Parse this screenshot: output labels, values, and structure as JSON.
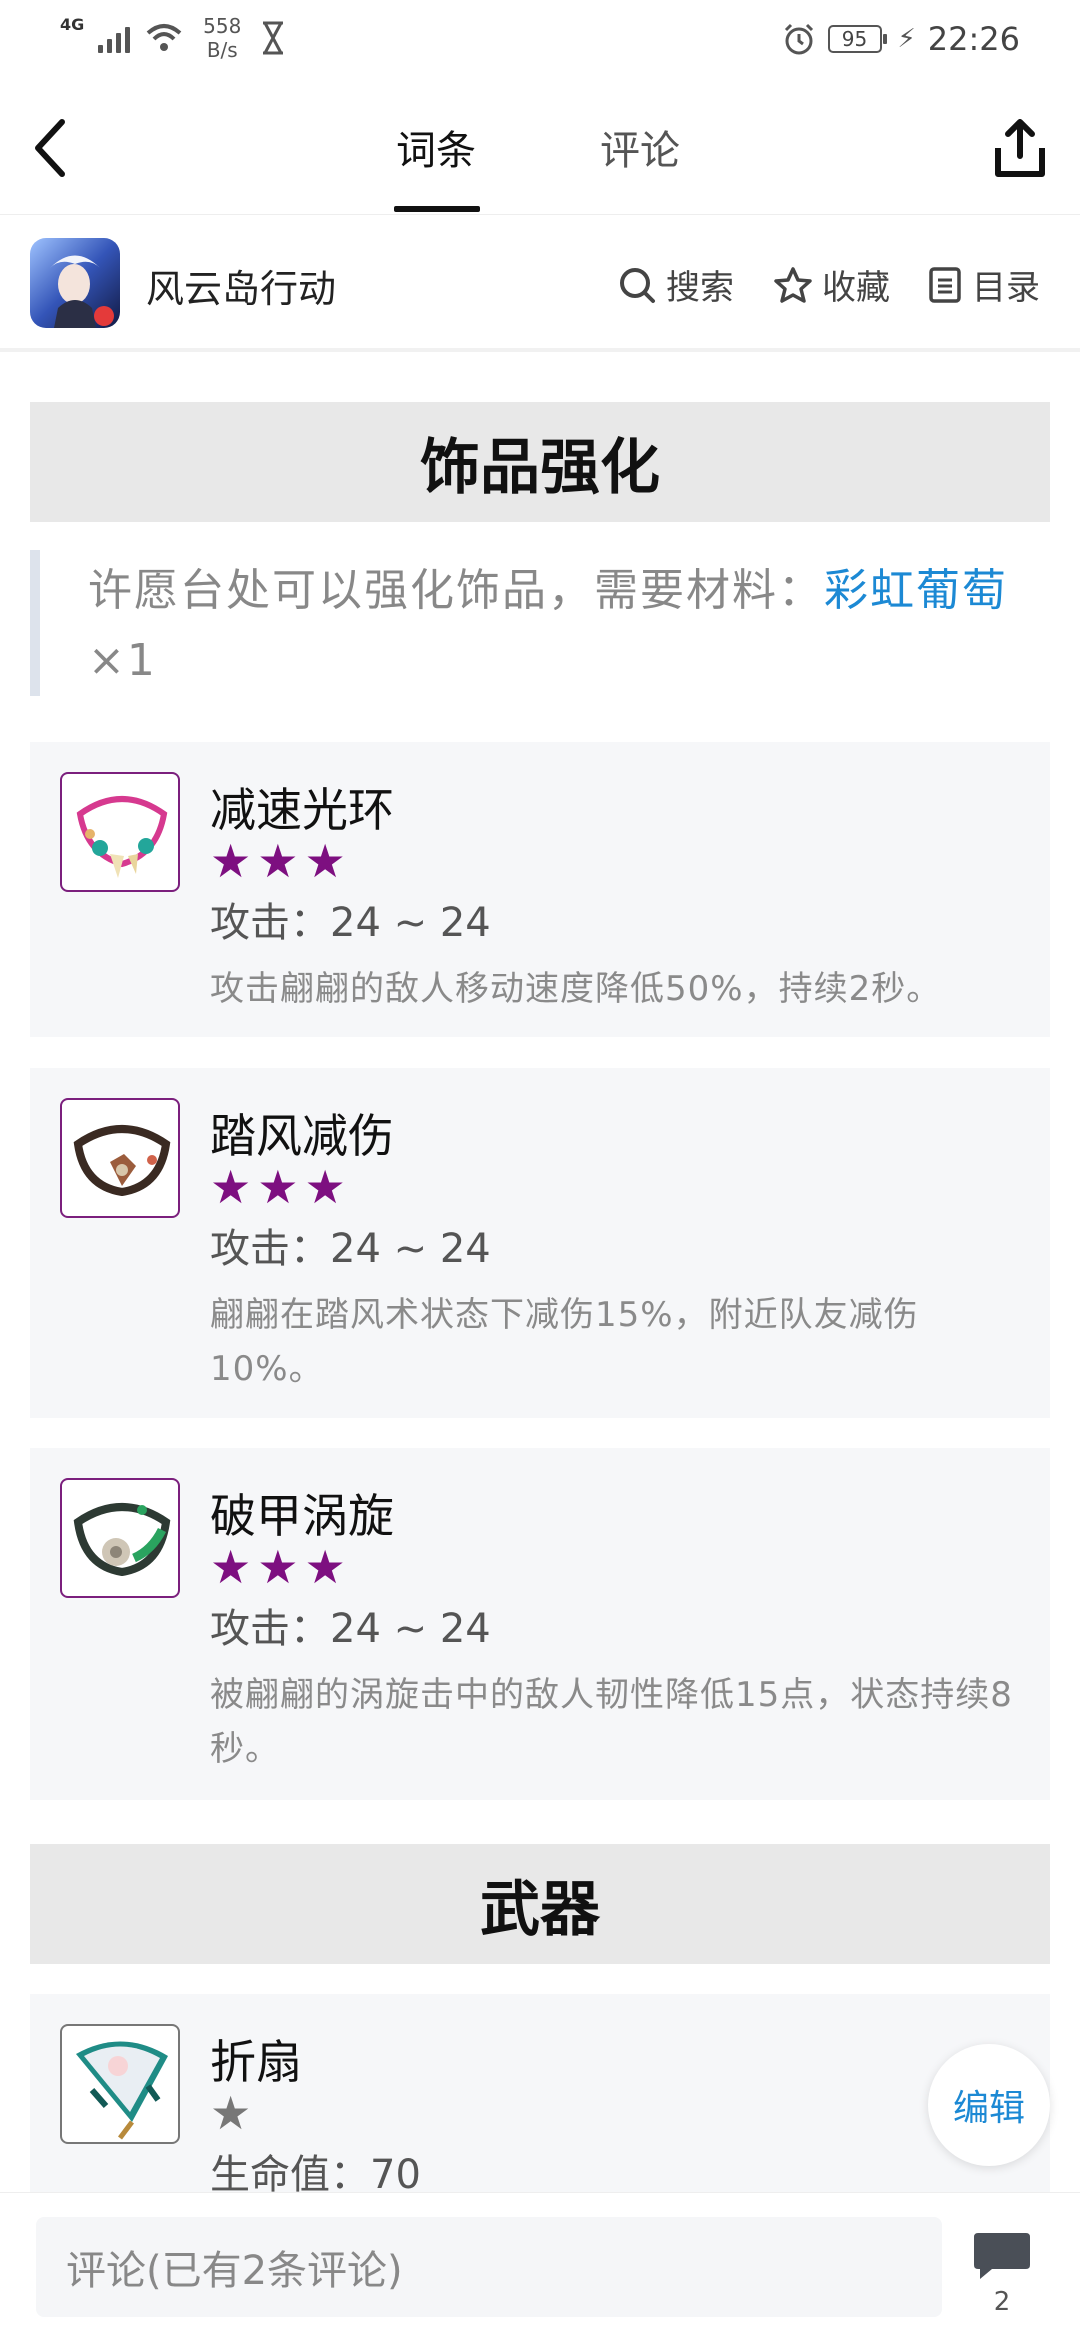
{
  "status_bar": {
    "network": "4G",
    "speed_value": "558",
    "speed_unit": "B/s",
    "battery": "95",
    "time": "22:26"
  },
  "nav": {
    "tabs": [
      {
        "label": "词条",
        "active": true
      },
      {
        "label": "评论",
        "active": false
      }
    ]
  },
  "subbar": {
    "app_name": "风云岛行动",
    "actions": [
      {
        "label": "搜索",
        "icon": "search-icon"
      },
      {
        "label": "收藏",
        "icon": "star-icon"
      },
      {
        "label": "目录",
        "icon": "list-icon"
      }
    ]
  },
  "sections": [
    {
      "title": "饰品强化"
    },
    {
      "title": "武器"
    }
  ],
  "note": {
    "text": "许愿台处可以强化饰品，需要材料：",
    "link": "彩虹葡萄",
    "suffix": "×1"
  },
  "cards": [
    {
      "name": "减速光环",
      "rating": 3,
      "star_color": "#7d0f80",
      "stat": "攻击：24 ~ 24",
      "desc": "攻击翩翩的敌人移动速度降低50%，持续2秒。"
    },
    {
      "name": "踏风减伤",
      "rating": 3,
      "star_color": "#7d0f80",
      "stat": "攻击：24 ~ 24",
      "desc": "翩翩在踏风术状态下减伤15%，附近队友减伤10%。"
    },
    {
      "name": "破甲涡旋",
      "rating": 3,
      "star_color": "#7d0f80",
      "stat": "攻击：24 ~ 24",
      "desc": "被翩翩的涡旋击中的敌人韧性降低15点，状态持续8秒。"
    },
    {
      "name": "折扇",
      "rating": 1,
      "star_color": "#777777",
      "stat": "生命值：70",
      "desc": ""
    }
  ],
  "edit_button": "编辑",
  "comment": {
    "placeholder": "评论(已有2条评论)",
    "count": "2"
  },
  "colors": {
    "accent_link": "#1c89d4",
    "rarity_purple": "#7d0f80"
  }
}
